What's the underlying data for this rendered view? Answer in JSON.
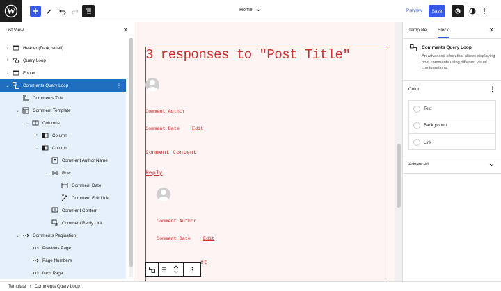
{
  "topbar": {
    "document_title": "Home",
    "preview_label": "Preview",
    "save_label": "Save"
  },
  "listview": {
    "title": "List View",
    "items": [
      {
        "label": "Header (Dark, small)",
        "icon": "template-part-icon",
        "caret": "›"
      },
      {
        "label": "Query Loop",
        "icon": "loop-icon",
        "caret": "›"
      },
      {
        "label": "Footer",
        "icon": "template-part-icon",
        "caret": "›"
      },
      {
        "label": "Comments Query Loop",
        "icon": "comments-query-loop-icon",
        "caret": "⌄"
      },
      {
        "label": "Comments Title",
        "icon": "comments-title-icon",
        "caret": ""
      },
      {
        "label": "Comment Template",
        "icon": "layout-icon",
        "caret": "⌄"
      },
      {
        "label": "Columns",
        "icon": "columns-icon",
        "caret": "⌄"
      },
      {
        "label": "Column",
        "icon": "column-icon",
        "caret": "›"
      },
      {
        "label": "Column",
        "icon": "column-icon",
        "caret": "⌄"
      },
      {
        "label": "Comment Author Name",
        "icon": "comment-author-icon",
        "caret": ""
      },
      {
        "label": "Row",
        "icon": "row-icon",
        "caret": "⌄"
      },
      {
        "label": "Comment Date",
        "icon": "comment-date-icon",
        "caret": ""
      },
      {
        "label": "Comment Edit Link",
        "icon": "comment-edit-icon",
        "caret": ""
      },
      {
        "label": "Comment Content",
        "icon": "comment-content-icon",
        "caret": ""
      },
      {
        "label": "Comment Reply Link",
        "icon": "comment-reply-icon",
        "caret": ""
      },
      {
        "label": "Comments Pagination",
        "icon": "pagination-icon",
        "caret": "⌄"
      },
      {
        "label": "Previous Page",
        "icon": "pagination-icon",
        "caret": ""
      },
      {
        "label": "Page Numbers",
        "icon": "pagination-icon",
        "caret": ""
      },
      {
        "label": "Next Page",
        "icon": "pagination-icon",
        "caret": ""
      }
    ]
  },
  "canvas": {
    "responses_title": "3 responses to \"Post Title\"",
    "comment1": {
      "author": "Comment Author",
      "date": "Comment Date",
      "edit": "Edit",
      "content": "Comment Content",
      "reply": "Reply"
    },
    "comment2": {
      "author": "Comment Author",
      "date": "Comment Date",
      "edit": "Edit",
      "content_partial": "nt"
    }
  },
  "sidebar": {
    "tab_template": "Template",
    "tab_block": "Block",
    "block_title": "Comments Query Loop",
    "block_desc": "An advanced block that allows displaying post comments using different visual configurations.",
    "color_section": "Color",
    "colors": [
      "Text",
      "Background",
      "Link"
    ],
    "advanced_section": "Advanced"
  },
  "footer": {
    "crumb_root": "Template",
    "crumb_sep": "›",
    "crumb_current": "Comments Query Loop"
  },
  "colors": {
    "accent": "#3858e9",
    "selected": "#1f6fbe",
    "canvas_bg": "#fef4f3",
    "text_red": "#cf2e2e"
  }
}
